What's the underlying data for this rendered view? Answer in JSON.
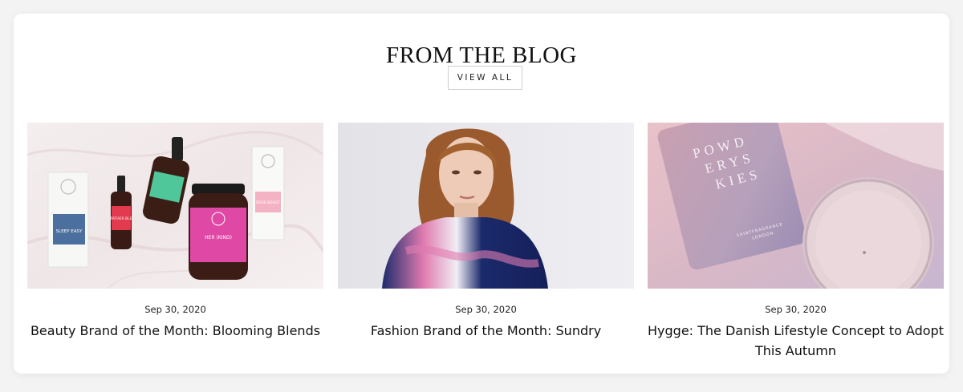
{
  "section": {
    "title": "FROM THE BLOG",
    "view_all_label": "VIEW ALL"
  },
  "posts": [
    {
      "date": "Sep 30, 2020",
      "title": "Beauty Brand of the Month: Blooming Blends",
      "image_labels": {
        "box_left": "SLEEP EASY",
        "small_bottle": "FATHER BLE",
        "jar": "HER (KIND)",
        "box_right": "ROSE BOOST"
      }
    },
    {
      "date": "Sep 30, 2020",
      "title": "Fashion Brand of the Month: Sundry"
    },
    {
      "date": "Sep 30, 2020",
      "title": "Hygge: The Danish Lifestyle Concept to Adopt This Autumn",
      "image_labels": {
        "candle_line1": "POWD",
        "candle_line2": "ERYS",
        "candle_line3": "KIES",
        "brand": "SAINTFRAGRANCE",
        "city": "LONDON"
      }
    }
  ],
  "colors": {
    "card_bg": "#ffffff",
    "page_bg": "#f3f3f3",
    "button_border": "#cfcfcf"
  }
}
